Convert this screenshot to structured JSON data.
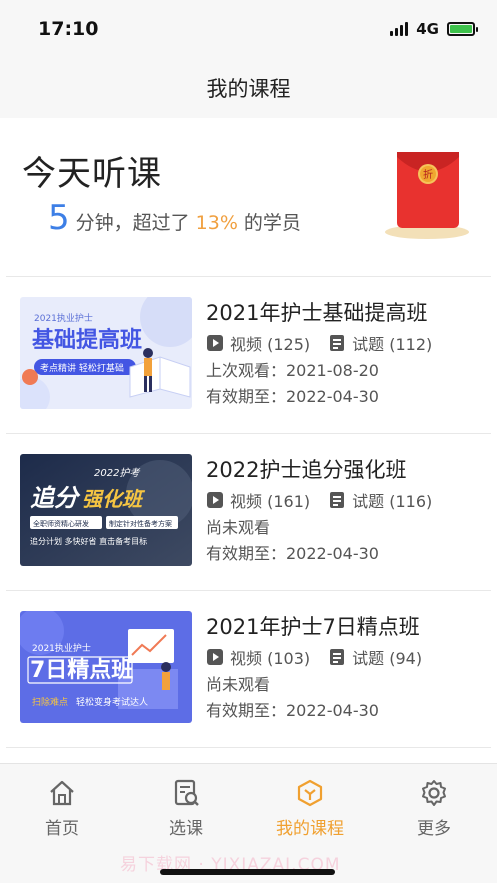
{
  "status": {
    "time": "17:10",
    "network": "4G"
  },
  "nav": {
    "title": "我的课程"
  },
  "today": {
    "title": "今天听课",
    "minutes": "5",
    "text1": "分钟，超过了",
    "percent": "13%",
    "text2": "的学员"
  },
  "courses": [
    {
      "title": "2021年护士基础提高班",
      "video": "视频 (125)",
      "quiz": "试题 (112)",
      "line1": "上次观看：2021-08-20",
      "line2": "有效期至：2022-04-30",
      "cover": {
        "top": "2021执业护士",
        "main": "基础提高班",
        "pill": "考点精讲  轻松打基础"
      }
    },
    {
      "title": "2022护士追分强化班",
      "video": "视频 (161)",
      "quiz": "试题 (116)",
      "line1": "尚未观看",
      "line2": "有效期至：2022-04-30",
      "cover": {
        "tag": "2022护考",
        "main1": "追分",
        "main2": "强化班",
        "chip1": "全职师资精心研发",
        "chip2": "制定针对性备考方案",
        "bottom": "追分计划 多快好省 直击备考目标"
      }
    },
    {
      "title": "2021年护士7日精点班",
      "video": "视频 (103)",
      "quiz": "试题 (94)",
      "line1": "尚未观看",
      "line2": "有效期至：2022-04-30",
      "cover": {
        "top": "2021执业护士",
        "main": "7日精点班",
        "bottom1": "扫除难点",
        "bottom2": "轻松变身考试达人"
      }
    }
  ],
  "tabs": [
    {
      "label": "首页",
      "icon": "home-icon"
    },
    {
      "label": "选课",
      "icon": "course-select-icon"
    },
    {
      "label": "我的课程",
      "icon": "my-courses-icon"
    },
    {
      "label": "更多",
      "icon": "gear-icon"
    }
  ],
  "watermark": "易下载网  ·  YIXIAZAI.COM",
  "colors": {
    "accent": "#f0a030",
    "blue": "#3d7fe6",
    "red": "#e63a3a"
  }
}
